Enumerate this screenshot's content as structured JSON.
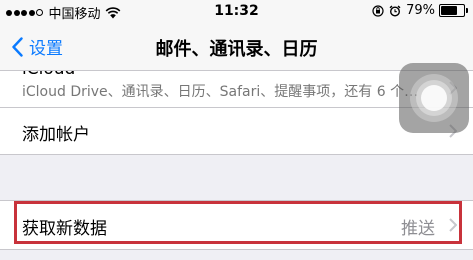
{
  "status_bar": {
    "carrier": "中国移动",
    "time": "11:32",
    "battery": "79%",
    "battery_level": 0.79,
    "icons": [
      "signal-dots-icon",
      "wifi-icon",
      "orientation-lock-icon",
      "alarm-icon",
      "battery-icon"
    ]
  },
  "nav": {
    "back_label": "设置",
    "title": "邮件、通讯录、日历"
  },
  "list": {
    "icloud_title": "iCloud",
    "icloud_subtitle": "iCloud Drive、通讯录、日历、Safari、提醒事项，还有 6 个…",
    "add_account_label": "添加帐户",
    "fetch_label": "获取新数据",
    "fetch_value": "推送"
  },
  "colors": {
    "accent": "#0a7aff",
    "highlight": "#c8323b",
    "background": "#efeff4"
  }
}
